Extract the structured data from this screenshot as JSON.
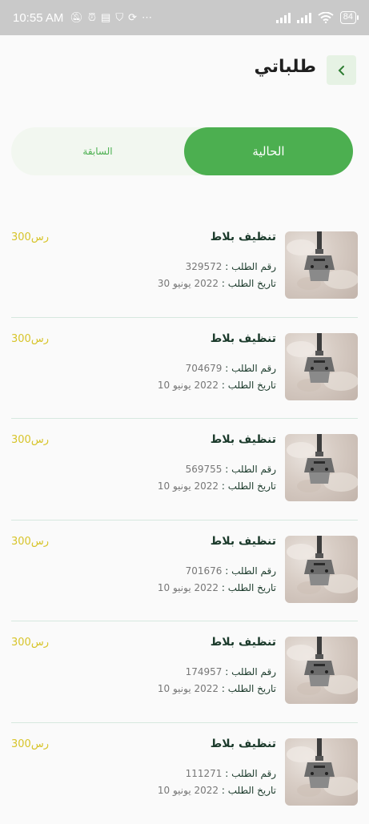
{
  "status_bar": {
    "time": "10:55 AM",
    "battery": "84",
    "icons": [
      "mute-icon",
      "alarm-icon",
      "message-icon",
      "shield-icon",
      "sync-icon",
      "more-icon"
    ]
  },
  "header": {
    "title": "طلباتي",
    "back_icon": "chevron-left-icon"
  },
  "tabs": {
    "current": "الحالية",
    "previous": "السابقة"
  },
  "colors": {
    "accent": "#4caf50",
    "price": "#d7c42a",
    "divider": "#d6e8df"
  },
  "orders": [
    {
      "service": "تنظيف بلاط",
      "price": "300رس",
      "number_label": "رقم الطلب :",
      "number": "329572",
      "date_label": "تاريخ الطلب :",
      "date": "2022 يونيو 30"
    },
    {
      "service": "تنظيف بلاط",
      "price": "300رس",
      "number_label": "رقم الطلب :",
      "number": "704679",
      "date_label": "تاريخ الطلب :",
      "date": "2022 يونيو 10"
    },
    {
      "service": "تنظيف بلاط",
      "price": "300رس",
      "number_label": "رقم الطلب :",
      "number": "569755",
      "date_label": "تاريخ الطلب :",
      "date": "2022 يونيو 10"
    },
    {
      "service": "تنظيف بلاط",
      "price": "300رس",
      "number_label": "رقم الطلب :",
      "number": "701676",
      "date_label": "تاريخ الطلب :",
      "date": "2022 يونيو 10"
    },
    {
      "service": "تنظيف بلاط",
      "price": "300رس",
      "number_label": "رقم الطلب :",
      "number": "174957",
      "date_label": "تاريخ الطلب :",
      "date": "2022 يونيو 10"
    },
    {
      "service": "تنظيف بلاط",
      "price": "300رس",
      "number_label": "رقم الطلب :",
      "number": "111271",
      "date_label": "تاريخ الطلب :",
      "date": "2022 يونيو 10"
    }
  ]
}
